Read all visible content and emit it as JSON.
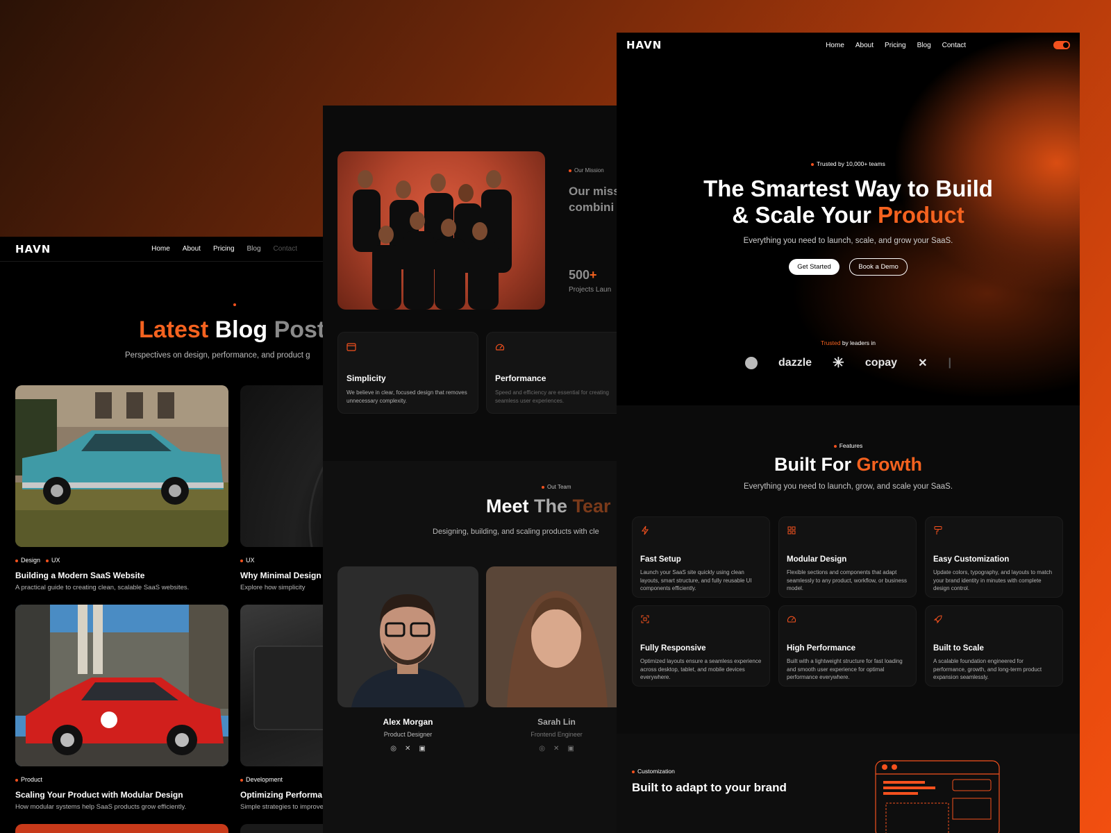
{
  "colors": {
    "accent": "#f4511e",
    "background": "#000000"
  },
  "blog": {
    "logo": "HAVN",
    "nav": [
      "Home",
      "About",
      "Pricing",
      "Blog",
      "Contact"
    ],
    "heading_accent": "Latest",
    "heading_rest": " Blog",
    "heading_fade": " Posts",
    "subtitle": "Perspectives on design, performance, and product g",
    "posts": [
      {
        "tags": [
          "Design",
          "UX"
        ],
        "title": "Building a Modern SaaS Website",
        "desc": "A practical guide to creating clean, scalable SaaS websites."
      },
      {
        "tags": [
          "UX"
        ],
        "title": "Why Minimal Design",
        "desc": "Explore how simplicity"
      },
      {
        "tags": [
          "Product"
        ],
        "title": "Scaling Your Product with Modular Design",
        "desc": "How modular systems help SaaS products grow efficiently."
      },
      {
        "tags": [
          "Development"
        ],
        "title": "Optimizing Performa",
        "desc": "Simple strategies to improve"
      }
    ]
  },
  "about": {
    "mission_label": "Our Mission",
    "mission_text": "Our miss modern combini scalable",
    "stat_value": "500",
    "stat_plus": "+",
    "stat_label": "Projects Laun",
    "values": [
      {
        "icon": "browser-window-icon",
        "title": "Simplicity",
        "desc": "We believe in clear, focused design that removes unnecessary complexity."
      },
      {
        "icon": "speedometer-icon",
        "title": "Performance",
        "desc": "Speed and efficiency are essential for creating seamless user experiences."
      }
    ],
    "team_label": "Out Team",
    "team_heading_a": "Meet",
    "team_heading_b": " The",
    "team_heading_c": " Tear",
    "team_sub": "Designing, building, and scaling products with cle",
    "members": [
      {
        "name": "Alex Morgan",
        "role": "Product Designer"
      },
      {
        "name": "Sarah Lin",
        "role": "Frontend Engineer"
      }
    ]
  },
  "landing": {
    "logo": "HAVN",
    "nav": [
      "Home",
      "About",
      "Pricing",
      "Blog",
      "Contact"
    ],
    "trusted": "Trusted by 10,000+ teams",
    "hero_line1": "The Smartest Way to Build",
    "hero_line2": "& Scale Your ",
    "hero_accent": "Product",
    "hero_sub": "Everything you need to launch, scale, and grow your SaaS.",
    "cta_primary": "Get Started",
    "cta_secondary": "Book a Demo",
    "leaders_accent": "Trusted",
    "leaders_rest": " by leaders in",
    "logos": [
      "dazzle",
      "copay"
    ],
    "features_label": "Features",
    "features_title": "Built For ",
    "features_accent": "Growth",
    "features_sub": "Everything you need to launch, grow, and scale your SaaS.",
    "features": [
      {
        "icon": "lightning-icon",
        "title": "Fast Setup",
        "desc": "Launch your SaaS site quickly using clean layouts, smart structure, and fully reusable UI components efficiently."
      },
      {
        "icon": "grid-icon",
        "title": "Modular Design",
        "desc": "Flexible sections and components that adapt seamlessly to any product, workflow, or business model."
      },
      {
        "icon": "paint-roller-icon",
        "title": "Easy Customization",
        "desc": "Update colors, typography, and layouts to match your brand identity in minutes with complete design control."
      },
      {
        "icon": "responsive-icon",
        "title": "Fully Responsive",
        "desc": "Optimized layouts ensure a seamless experience across desktop, tablet, and mobile devices everywhere."
      },
      {
        "icon": "speedometer-icon",
        "title": "High Performance",
        "desc": "Built with a lightweight structure for fast loading and smooth user experience for optimal performance everywhere."
      },
      {
        "icon": "rocket-icon",
        "title": "Built to Scale",
        "desc": "A scalable foundation engineered for performance, growth, and long-term product expansion seamlessly."
      }
    ],
    "custom_label": "Customization",
    "custom_title": "Built to adapt to your brand"
  }
}
